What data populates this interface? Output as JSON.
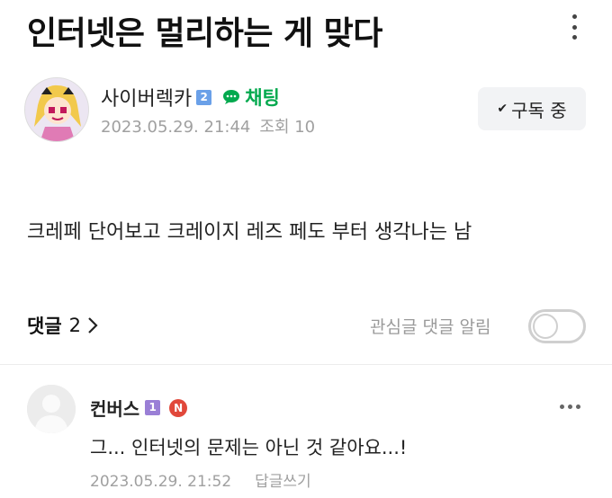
{
  "post": {
    "title": "인터넷은 멀리하는 게 맞다",
    "author": "사이버렉카",
    "author_level": "2",
    "chat_label": "채팅",
    "date": "2023.05.29. 21:44",
    "views": "조회 10",
    "subscribe_label": "구독 중",
    "body": "크레페 단어보고 크레이지 레즈 페도 부터 생각나는 남"
  },
  "comments_section": {
    "label": "댓글",
    "count": "2",
    "notify_label": "관심글 댓글 알림",
    "notify_enabled": false
  },
  "comment": {
    "author": "컨버스",
    "level": "1",
    "new_badge": "N",
    "text": "그... 인터넷의 문제는 아닌 것 같아요...!",
    "date": "2023.05.29. 21:52",
    "reply_label": "답글쓰기"
  },
  "colors": {
    "chat_green": "#03a94e",
    "level2_blue": "#6aa0e8",
    "level1_purple": "#9a7fd6",
    "new_red": "#e1483b"
  },
  "icons": [
    "more-vertical-icon",
    "chat-bubble-icon",
    "check-icon",
    "chevron-right-icon",
    "more-horizontal-icon"
  ]
}
